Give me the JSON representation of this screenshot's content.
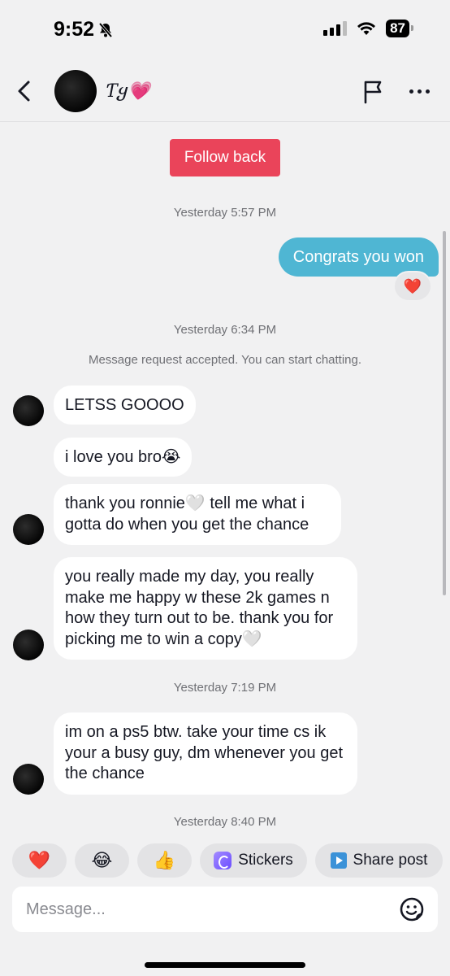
{
  "status_bar": {
    "time": "9:52",
    "battery": "87"
  },
  "header": {
    "username": "Ƭყ",
    "username_emoji": "💗"
  },
  "follow_back_label": "Follow back",
  "timestamps": {
    "t1": "Yesterday 5:57 PM",
    "t2": "Yesterday 6:34 PM",
    "t3": "Yesterday 7:19 PM",
    "t4": "Yesterday 8:40 PM"
  },
  "system_message": "Message request accepted. You can start chatting.",
  "outgoing": {
    "text": "Congrats you won",
    "reaction": "❤️"
  },
  "incoming": [
    {
      "text": "LETSS GOOOO"
    },
    {
      "text": "i love you bro😭"
    },
    {
      "text": "thank you ronnie🤍  tell me what i gotta do when you get the chance"
    },
    {
      "text": "you really made my day, you really make me happy w these 2k games n how they turn out to be. thank you for picking me to win a copy🤍"
    },
    {
      "text": "im on a ps5 btw. take your time cs ik your a busy guy, dm whenever you get the chance"
    }
  ],
  "quick_actions": {
    "heart": "❤️",
    "laugh": "😂",
    "thumbs": "👍",
    "stickers_label": "Stickers",
    "share_label": "Share post"
  },
  "composer": {
    "placeholder": "Message..."
  },
  "icons": {
    "back": "chevron-left-icon",
    "flag": "flag-icon",
    "more": "more-dots-icon",
    "mute": "bell-slash-icon",
    "emoji": "emoji-face-icon",
    "stickers": "sticker-icon",
    "share": "share-post-icon"
  }
}
